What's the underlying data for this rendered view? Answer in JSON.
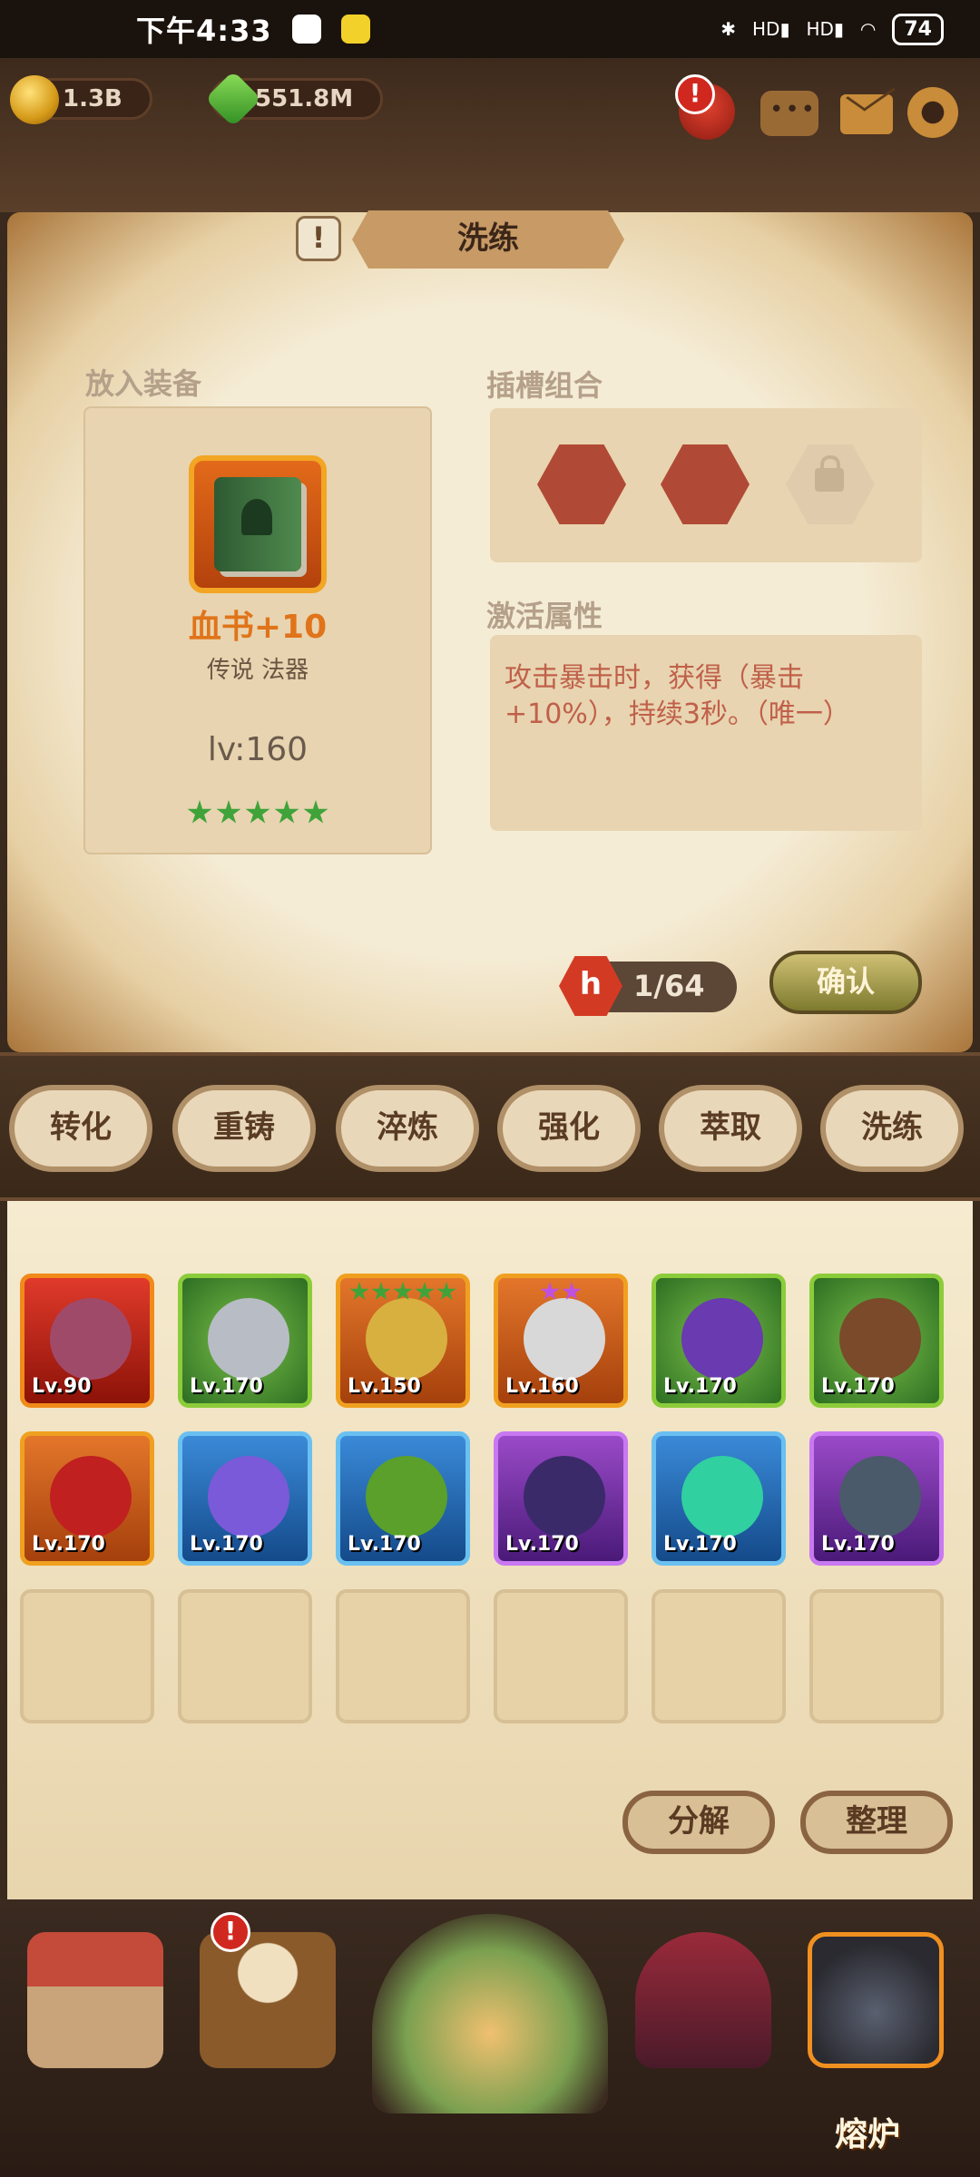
{
  "status_bar": {
    "time": "下午4:33",
    "battery": "74",
    "net1": "HD",
    "net2": "HD"
  },
  "resources": {
    "gold": "1.3B",
    "gems": "551.8M"
  },
  "header": {
    "title": "洗练",
    "alert": "!"
  },
  "sections": {
    "equip_label": "放入装备",
    "slot_label": "插槽组合",
    "attr_label": "激活属性"
  },
  "equipment": {
    "name": "血书+10",
    "subtitle": "传说 法器",
    "level": "lv:160",
    "stars": 5
  },
  "attribute_text": "攻击暴击时，获得（暴击+10%），持续3秒。（唯一）",
  "cost": {
    "label": "1/64",
    "icon": "h"
  },
  "confirm_label": "确认",
  "tabs": [
    "转化",
    "重铸",
    "淬炼",
    "强化",
    "萃取",
    "洗练"
  ],
  "inventory": [
    {
      "lv": "Lv.90",
      "rarity": "red",
      "icon": "ring-icon",
      "stars": 0
    },
    {
      "lv": "Lv.170",
      "rarity": "green",
      "icon": "armor-icon",
      "stars": 0
    },
    {
      "lv": "Lv.150",
      "rarity": "orange",
      "icon": "amulet-icon",
      "stars": 5,
      "star_color": "#3fa33a"
    },
    {
      "lv": "Lv.160",
      "rarity": "orange",
      "icon": "cloak-icon",
      "stars": 2,
      "star_color": "#c050e0"
    },
    {
      "lv": "Lv.170",
      "rarity": "green",
      "icon": "wizard-hat-icon",
      "stars": 0
    },
    {
      "lv": "Lv.170",
      "rarity": "green",
      "icon": "glove-icon",
      "stars": 0
    },
    {
      "lv": "Lv.170",
      "rarity": "orange",
      "icon": "necklace-icon",
      "stars": 0
    },
    {
      "lv": "Lv.170",
      "rarity": "blue",
      "icon": "robe-icon",
      "stars": 0
    },
    {
      "lv": "Lv.170",
      "rarity": "blue",
      "icon": "hood-icon",
      "stars": 0
    },
    {
      "lv": "Lv.170",
      "rarity": "purple",
      "icon": "hat-icon",
      "stars": 0
    },
    {
      "lv": "Lv.170",
      "rarity": "blue",
      "icon": "gem-amulet-icon",
      "stars": 0
    },
    {
      "lv": "Lv.170",
      "rarity": "purple",
      "icon": "horned-helmet-icon",
      "stars": 0
    }
  ],
  "actions": {
    "decompose": "分解",
    "sort": "整理"
  },
  "nav": {
    "forge_label": "熔炉",
    "tavern_alert": "!"
  }
}
